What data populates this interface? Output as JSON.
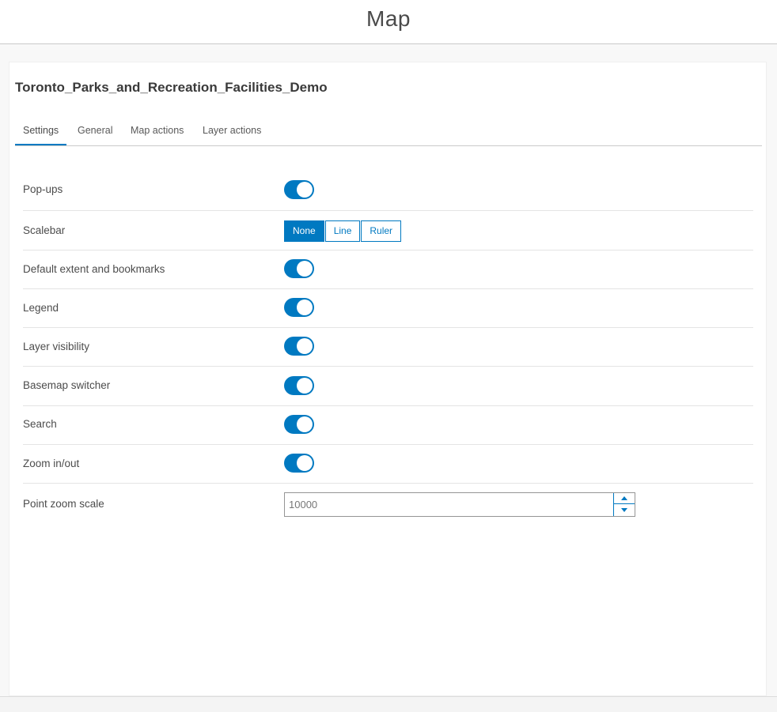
{
  "header": {
    "title": "Map"
  },
  "panel": {
    "title": "Toronto_Parks_and_Recreation_Facilities_Demo",
    "tabs": [
      {
        "label": "Settings",
        "active": true
      },
      {
        "label": "General",
        "active": false
      },
      {
        "label": "Map actions",
        "active": false
      },
      {
        "label": "Layer actions",
        "active": false
      }
    ]
  },
  "settings": {
    "popups": {
      "label": "Pop-ups",
      "enabled": true
    },
    "scalebar": {
      "label": "Scalebar",
      "options": [
        "None",
        "Line",
        "Ruler"
      ],
      "selected": "None"
    },
    "default_extent": {
      "label": "Default extent and bookmarks",
      "enabled": true
    },
    "legend": {
      "label": "Legend",
      "enabled": true
    },
    "layer_visibility": {
      "label": "Layer visibility",
      "enabled": true
    },
    "basemap_switcher": {
      "label": "Basemap switcher",
      "enabled": true
    },
    "search": {
      "label": "Search",
      "enabled": true
    },
    "zoom": {
      "label": "Zoom in/out",
      "enabled": true
    },
    "point_zoom_scale": {
      "label": "Point zoom scale",
      "value": "10000"
    }
  },
  "colors": {
    "accent": "#0079c1",
    "text": "#4c4c4c",
    "divider": "#e4e4e4"
  },
  "icons": {
    "stepper_up": "chevron-up-icon",
    "stepper_down": "chevron-down-icon"
  }
}
